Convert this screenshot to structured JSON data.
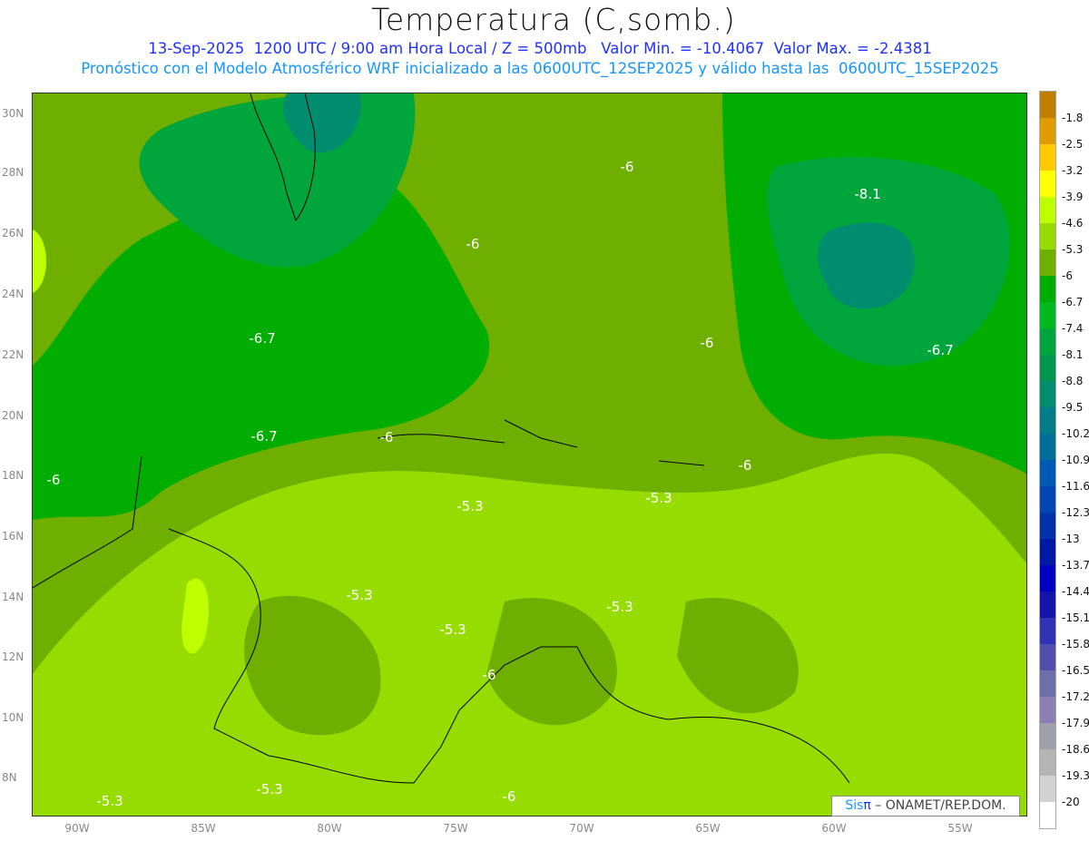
{
  "title": "Temperatura (C,somb.)",
  "subtitle1": "13-Sep-2025  1200 UTC / 9:00 am Hora Local / Z = 500mb   Valor Min. = -10.4067  Valor Max. = -2.4381",
  "subtitle2": "Pronóstico con el Modelo Atmosférico WRF inicializado a las 0600UTC_12SEP2025 y válido hasta las  0600UTC_15SEP2025",
  "lat_labels": [
    "30N",
    "28N",
    "26N",
    "24N",
    "22N",
    "20N",
    "18N",
    "16N",
    "14N",
    "12N",
    "10N",
    "8N"
  ],
  "lon_labels": [
    "90W",
    "85W",
    "80W",
    "75W",
    "70W",
    "65W",
    "60W",
    "55W"
  ],
  "contour_labels": [
    "-6",
    "-8.1",
    "-6",
    "-6.7",
    "-6",
    "-6.7",
    "-6.7",
    "-6",
    "-6",
    "-6",
    "-5.3",
    "-5.3",
    "-5.3",
    "-5.3",
    "-5.3",
    "-6",
    "-5.3",
    "-5.3",
    "-6"
  ],
  "colorbar": {
    "labels": [
      "-1.8",
      "-2.5",
      "-3.2",
      "-3.9",
      "-4.6",
      "-5.3",
      "-6",
      "-6.7",
      "-7.4",
      "-8.1",
      "-8.8",
      "-9.5",
      "-10.2",
      "-10.9",
      "-11.6",
      "-12.3",
      "-13",
      "-13.7",
      "-14.4",
      "-15.1",
      "-15.8",
      "-16.5",
      "-17.2",
      "-17.9",
      "-18.6",
      "-19.3",
      "-20"
    ],
    "colors": [
      "#bf7f00",
      "#df9b00",
      "#ffc800",
      "#ffff00",
      "#beff00",
      "#96dc00",
      "#6eaf00",
      "#00ad00",
      "#00b91e",
      "#00a53c",
      "#009650",
      "#008c6e",
      "#007d87",
      "#006e9b",
      "#005ab4",
      "#0046b4",
      "#0032aa",
      "#0019a5",
      "#0000c3",
      "#1414aa",
      "#3232b4",
      "#5050aa",
      "#6e6eaa",
      "#8c7db4",
      "#a0a0aa",
      "#b4b4b4",
      "#d2d2d2",
      "#ffffff"
    ]
  },
  "credit": {
    "sis": "Sis",
    "pi": "π",
    "rest": " – ONAMET/REP.DOM."
  }
}
